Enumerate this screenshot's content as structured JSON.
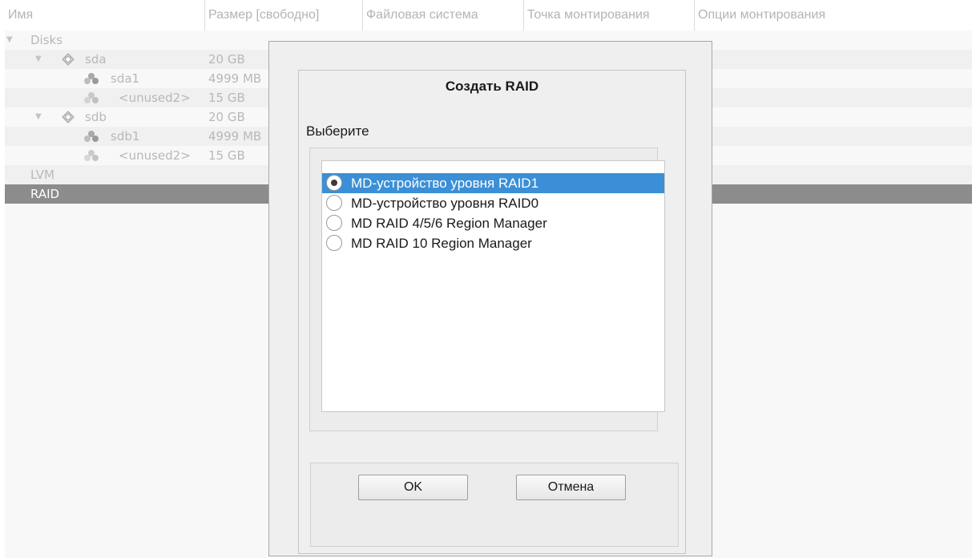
{
  "columns": [
    "Имя",
    "Размер [свободно]",
    "Файловая система",
    "Точка монтирования",
    "Опции монтирования"
  ],
  "tree": {
    "disks_label": "Disks",
    "sda": {
      "name": "sda",
      "size": "20 GB"
    },
    "sda1": {
      "name": "sda1",
      "size": "4999 MB"
    },
    "sda_unused": {
      "name": "<unused2>",
      "size": "15 GB"
    },
    "sdb": {
      "name": "sdb",
      "size": "20 GB"
    },
    "sdb1": {
      "name": "sdb1",
      "size": "4999 MB"
    },
    "sdb_unused": {
      "name": "<unused2>",
      "size": "15 GB"
    },
    "lvm_label": "LVM",
    "raid_label": "RAID"
  },
  "dialog": {
    "title": "Создать RAID",
    "choose_label": "Выберите",
    "options": [
      "MD-устройство уровня RAID1",
      "MD-устройство уровня RAID0",
      "MD RAID 4/5/6 Region Manager",
      "MD RAID 10 Region Manager"
    ],
    "selected_index": 0,
    "ok_label": "OK",
    "cancel_label": "Отмена"
  },
  "colors": {
    "selection": "#3b8fd6",
    "tree_selected_row": "#8c8c8c",
    "dialog_bg": "#efefef"
  },
  "icons": {
    "expand": "chevron-down-icon",
    "disk": "hard-disk-icon",
    "partition": "partition-icon"
  }
}
